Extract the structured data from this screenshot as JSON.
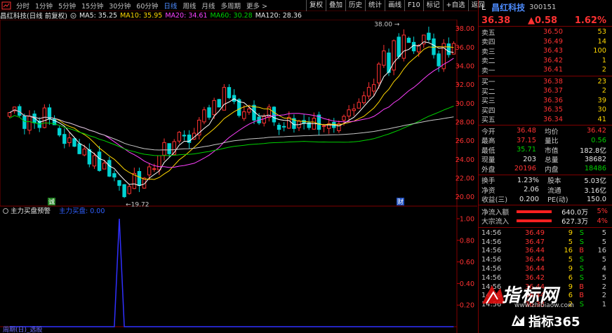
{
  "toolbar": {
    "periods": [
      "分时",
      "1分钟",
      "5分钟",
      "15分钟",
      "30分钟",
      "60分钟",
      "日线",
      "周线",
      "月线",
      "多周期",
      "更多 >"
    ],
    "active_period": "日线",
    "buttons": [
      "复权",
      "叠加",
      "历史",
      "统计",
      "画线",
      "F10",
      "标记",
      "+自选",
      "返回"
    ]
  },
  "infoline": {
    "stock": "昌红科技(日线 前复权)",
    "ma5": "MA5: 35.25",
    "ma10": "MA10: 35.95",
    "ma20": "MA20: 34.61",
    "ma60": "MA60: 30.28",
    "ma120": "MA120: 28.36"
  },
  "colors": {
    "ma5": "#ffffff",
    "ma10": "#ffd700",
    "ma20": "#ff40ff",
    "ma60": "#00d200",
    "ma120": "#c8c8c8",
    "up": "#ff3232",
    "down": "#00d2d2",
    "grid_border": "#800000",
    "indicator": "#3030ff"
  },
  "chart_data": {
    "type": "candlestick",
    "price_axis": {
      "labels": [
        "38.00",
        "36.00",
        "34.00",
        "32.00",
        "30.00",
        "28.00",
        "26.00",
        "24.00",
        "22.00",
        "20.00"
      ],
      "min": 19.0,
      "max": 38.8
    },
    "annotations": {
      "high": "38.00",
      "low": "19.72",
      "buy_marker": "诚",
      "sell_marker": "财"
    },
    "closes": [
      29.0,
      29.6,
      28.7,
      27.3,
      28.6,
      27.9,
      27.4,
      29.5,
      28.3,
      27.7,
      26.6,
      25.7,
      26.3,
      25.4,
      24.6,
      25.1,
      23.5,
      24.4,
      22.8,
      23.6,
      22.2,
      22.1,
      21.2,
      20.0,
      21.1,
      22.5,
      21.2,
      22.0,
      23.2,
      23.0,
      24.4,
      25.8,
      24.6,
      25.9,
      26.9,
      26.5,
      25.8,
      26.8,
      28.2,
      29.3,
      28.5,
      30.3,
      29.6,
      31.7,
      30.6,
      30.2,
      28.7,
      29.1,
      29.4,
      28.2,
      27.9,
      28.6,
      29.6,
      28.0,
      27.2,
      27.5,
      28.5,
      27.3,
      28.1,
      27.9,
      27.4,
      28.4,
      27.2,
      27.6,
      27.8,
      27.4,
      27.8,
      28.6,
      29.3,
      29.4,
      30.1,
      30.8,
      31.7,
      32.0,
      34.2,
      35.6,
      33.3,
      36.7,
      35.0,
      37.3,
      36.5,
      35.6,
      36.2,
      37.3,
      36.8,
      35.2,
      34.0,
      36.4,
      35.2,
      36.4
    ],
    "indicator": {
      "title": "主力买盘预警",
      "value_label": "主力买盘: 0.00",
      "axis_labels": [
        "1.00",
        "0.80",
        "0.60",
        "0.40",
        "0.20"
      ],
      "spike_index": 22,
      "spike_value": 1.0
    },
    "footer_label": "周期(日)_选股"
  },
  "panel": {
    "name": "昌红科技",
    "code": "300151",
    "price": "36.38",
    "change": "▲0.58",
    "change_pct": "1.62%",
    "asks": [
      {
        "label": "卖五",
        "price": "36.50",
        "vol": "53"
      },
      {
        "label": "卖四",
        "price": "36.49",
        "vol": "14"
      },
      {
        "label": "卖三",
        "price": "36.43",
        "vol": "100"
      },
      {
        "label": "卖二",
        "price": "36.42",
        "vol": "1"
      },
      {
        "label": "卖一",
        "price": "36.41",
        "vol": "2"
      }
    ],
    "bids": [
      {
        "label": "买一",
        "price": "36.38",
        "vol": "23"
      },
      {
        "label": "买二",
        "price": "36.37",
        "vol": "2"
      },
      {
        "label": "买三",
        "price": "36.36",
        "vol": "39"
      },
      {
        "label": "买四",
        "price": "36.35",
        "vol": "30"
      },
      {
        "label": "买五",
        "price": "36.34",
        "vol": "41"
      }
    ],
    "stats1": [
      {
        "k1": "今开",
        "v1": "36.48",
        "k2": "均价",
        "v2": "36.42",
        "c1": "red",
        "c2": "red"
      },
      {
        "k1": "最高",
        "v1": "37.15",
        "k2": "量比",
        "v2": "0.56",
        "c1": "red",
        "c2": "green"
      },
      {
        "k1": "最低",
        "v1": "35.71",
        "k2": "市值",
        "v2": "182.8亿",
        "c1": "green",
        "c2": "white"
      },
      {
        "k1": "现量",
        "v1": "203",
        "k2": "总量",
        "v2": "38682",
        "c1": "white",
        "c2": "white"
      },
      {
        "k1": "外盘",
        "v1": "20196",
        "k2": "内盘",
        "v2": "18486",
        "c1": "red",
        "c2": "green"
      }
    ],
    "stats2": [
      {
        "k1": "换手",
        "v1": "1.23%",
        "k2": "股本",
        "v2": "5.03亿"
      },
      {
        "k1": "净资",
        "v1": "2.06",
        "k2": "流通",
        "v2": "3.16亿"
      },
      {
        "k1": "收益(三)",
        "v1": "0.200",
        "k2": "PE(动)",
        "v2": "150.0"
      }
    ],
    "flows": [
      {
        "label": "净流入额",
        "value": "640.0万",
        "pct": "5%"
      },
      {
        "label": "大宗流入",
        "value": "627.3万",
        "pct": "4%"
      }
    ],
    "trades": [
      {
        "time": "14:56",
        "price": "36.49",
        "vol": "9",
        "side": "S",
        "num": "5"
      },
      {
        "time": "14:56",
        "price": "36.47",
        "vol": "5",
        "side": "S",
        "num": "5"
      },
      {
        "time": "14:56",
        "price": "36.44",
        "vol": "16",
        "side": "B",
        "num": "16"
      },
      {
        "time": "14:56",
        "price": "36.44",
        "vol": "5",
        "side": "S",
        "num": "5"
      },
      {
        "time": "14:56",
        "price": "36.44",
        "vol": "9",
        "side": "S",
        "num": "4"
      },
      {
        "time": "14:56",
        "price": "36.42",
        "vol": "6",
        "side": "S",
        "num": "5"
      },
      {
        "time": "14:56",
        "price": "36.44",
        "vol": "9",
        "side": "B",
        "num": "2"
      },
      {
        "time": "14:56",
        "price": "36.44",
        "vol": "6",
        "side": "B",
        "num": "2"
      },
      {
        "time": "14:56",
        "price": "36.38",
        "vol": "2",
        "side": "S",
        "num": "1"
      }
    ]
  },
  "watermark": {
    "brand": "指标网",
    "url": "www.zhibiaow.com",
    "brand2": "指标365"
  }
}
